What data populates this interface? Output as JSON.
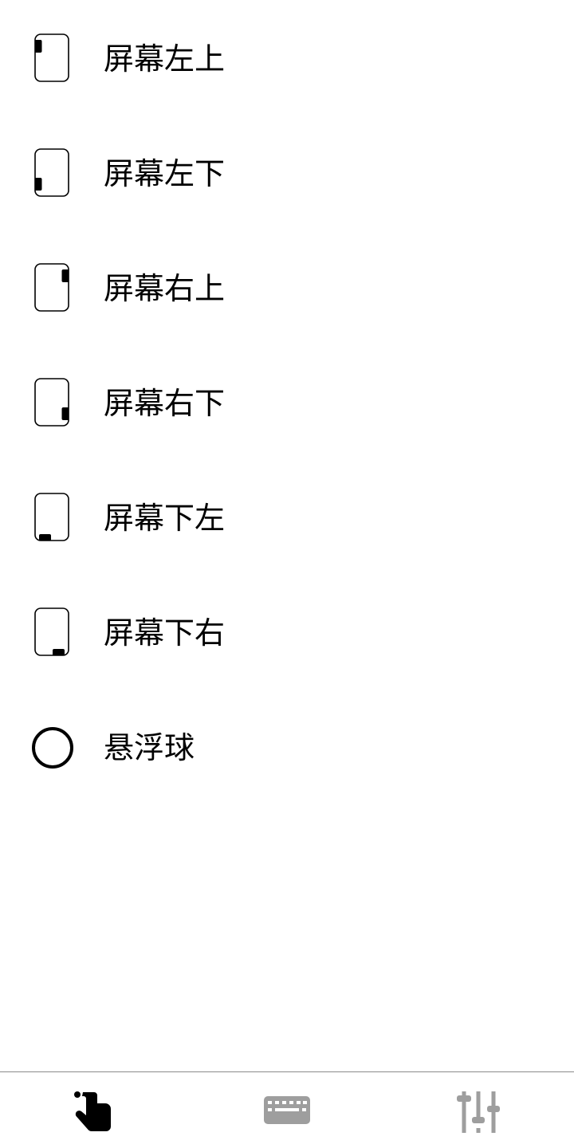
{
  "position_options": [
    {
      "id": "top-left",
      "label": "屏幕左上",
      "icon": "phone-corner-top-left-icon"
    },
    {
      "id": "bottom-left",
      "label": "屏幕左下",
      "icon": "phone-corner-bottom-left-icon"
    },
    {
      "id": "top-right",
      "label": "屏幕右上",
      "icon": "phone-corner-top-right-icon"
    },
    {
      "id": "bottom-right",
      "label": "屏幕右下",
      "icon": "phone-corner-bottom-right-icon"
    },
    {
      "id": "bottom-left-edge",
      "label": "屏幕下左",
      "icon": "phone-bottom-left-icon"
    },
    {
      "id": "bottom-right-edge",
      "label": "屏幕下右",
      "icon": "phone-bottom-right-icon"
    },
    {
      "id": "floating-ball",
      "label": "悬浮球",
      "icon": "circle-icon"
    }
  ],
  "bottom_nav": {
    "tabs": [
      {
        "id": "gesture",
        "icon": "touch-hand-icon",
        "active": true,
        "color": "#000000"
      },
      {
        "id": "keyboard",
        "icon": "keyboard-icon",
        "active": false,
        "color": "#9e9e9e"
      },
      {
        "id": "settings",
        "icon": "sliders-icon",
        "active": false,
        "color": "#9e9e9e"
      }
    ]
  },
  "colors": {
    "text": "#000000",
    "inactive_icon": "#9e9e9e",
    "divider": "#8a8a8a",
    "background": "#ffffff"
  }
}
